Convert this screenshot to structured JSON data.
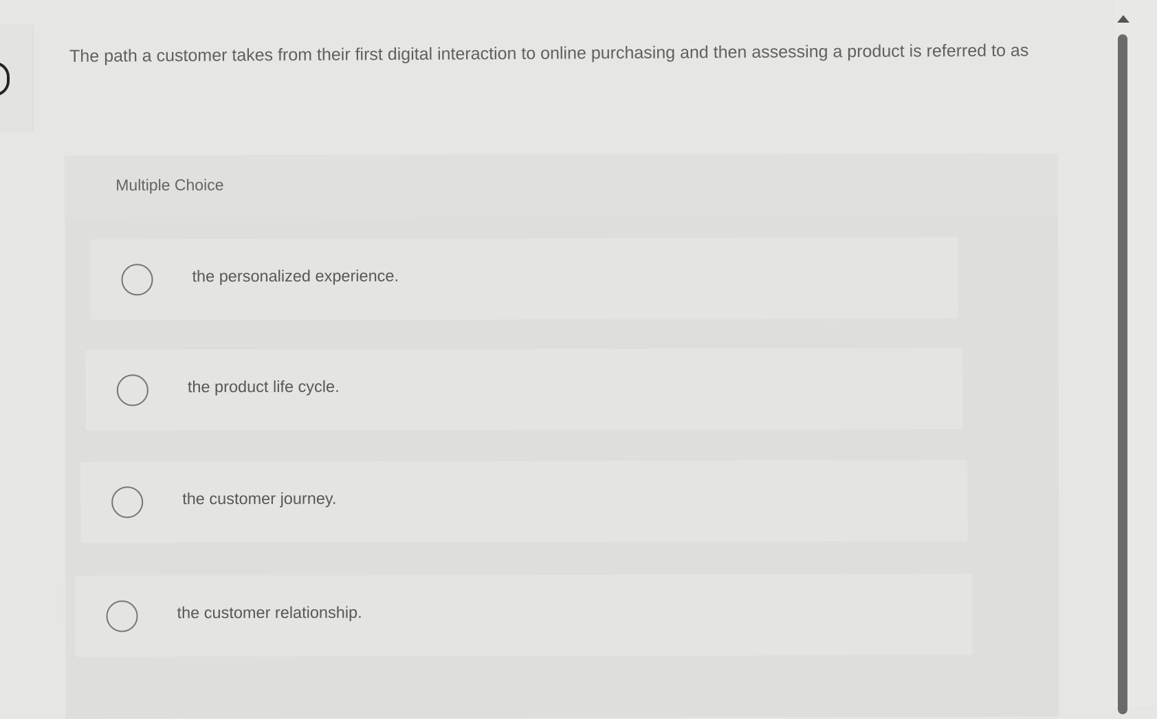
{
  "question": {
    "text": "The path a customer takes from their first digital interaction to online purchasing and then assessing a product is referred to as"
  },
  "choices": {
    "header": "Multiple Choice",
    "options": [
      {
        "label": "the personalized experience."
      },
      {
        "label": "the product life cycle."
      },
      {
        "label": "the customer journey."
      },
      {
        "label": "the customer relationship."
      }
    ]
  },
  "icons": {
    "radio": "radio-button-icon",
    "scroll_up": "triangle-up-icon"
  },
  "colors": {
    "background": "#e6e6e4",
    "text": "#606060",
    "radio_border": "#777777",
    "scroll_thumb": "#6a6a6a"
  }
}
